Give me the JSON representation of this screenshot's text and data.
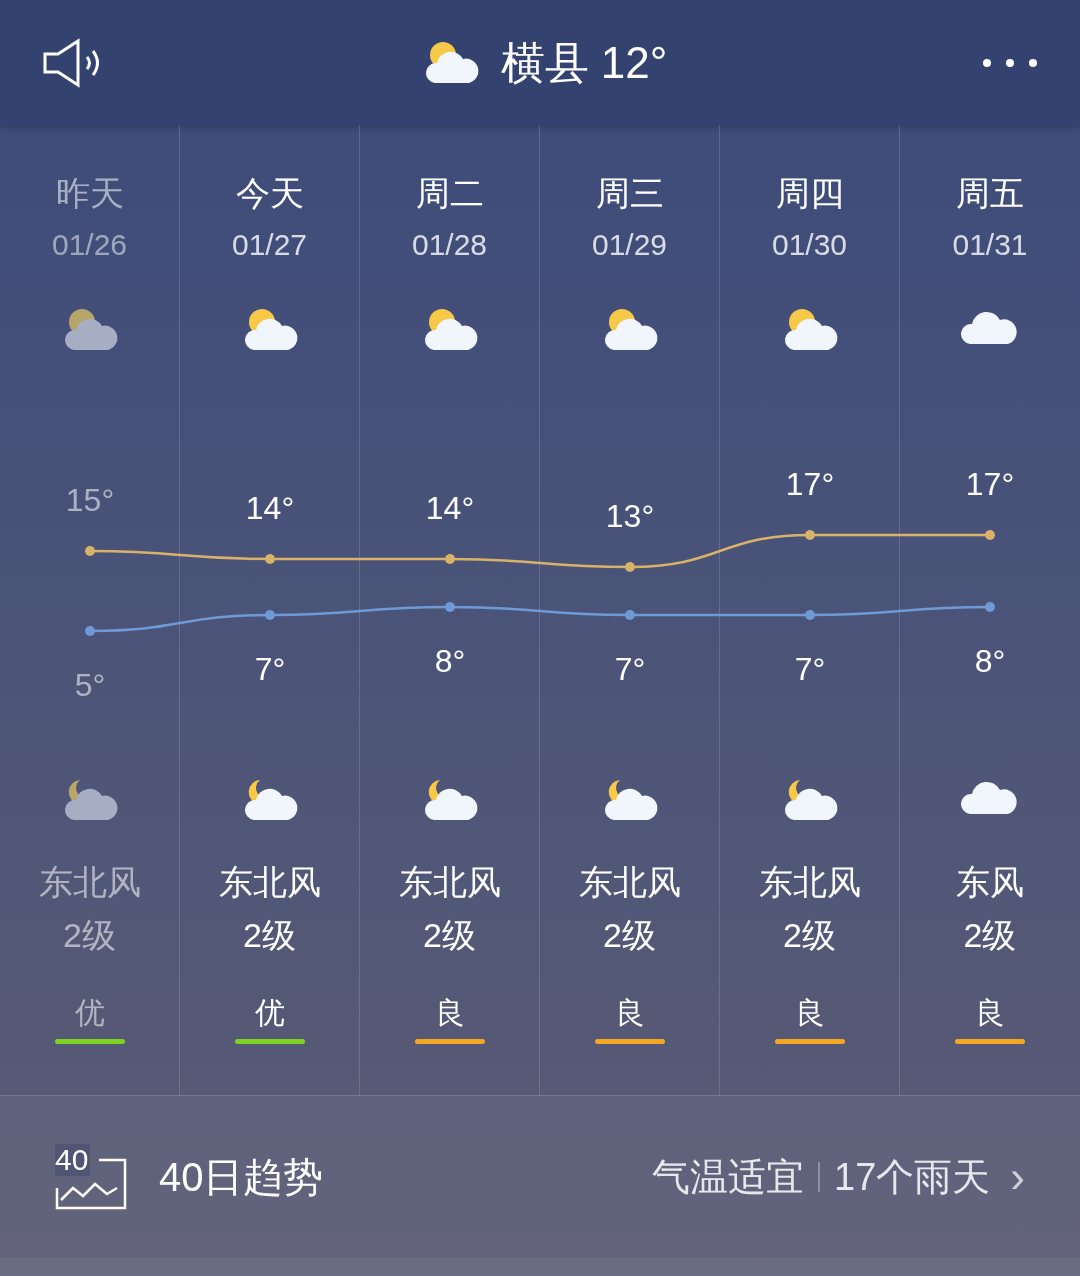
{
  "header": {
    "weather_icon": {
      "kind": "partly_cloudy"
    },
    "title": "横县 12°"
  },
  "forecast": {
    "days": [
      {
        "name": "昨天",
        "date": "01/26",
        "day_icon": {
          "kind": "partly_cloudy"
        },
        "night_icon": {
          "kind": "partly_cloudy_night"
        },
        "wind": "东北风",
        "wind_level": "2级",
        "aqi": "优",
        "color": "#7ed321",
        "past": true
      },
      {
        "name": "今天",
        "date": "01/27",
        "day_icon": {
          "kind": "partly_cloudy"
        },
        "night_icon": {
          "kind": "partly_cloudy_night"
        },
        "wind": "东北风",
        "wind_level": "2级",
        "aqi": "优",
        "color": "#7ed321",
        "past": false
      },
      {
        "name": "周二",
        "date": "01/28",
        "day_icon": {
          "kind": "partly_cloudy"
        },
        "night_icon": {
          "kind": "partly_cloudy_night"
        },
        "wind": "东北风",
        "wind_level": "2级",
        "aqi": "良",
        "color": "#f5a623",
        "past": false
      },
      {
        "name": "周三",
        "date": "01/29",
        "day_icon": {
          "kind": "partly_cloudy"
        },
        "night_icon": {
          "kind": "partly_cloudy_night"
        },
        "wind": "东北风",
        "wind_level": "2级",
        "aqi": "良",
        "color": "#f5a623",
        "past": false
      },
      {
        "name": "周四",
        "date": "01/30",
        "day_icon": {
          "kind": "partly_cloudy"
        },
        "night_icon": {
          "kind": "partly_cloudy_night"
        },
        "wind": "东北风",
        "wind_level": "2级",
        "aqi": "良",
        "color": "#f5a623",
        "past": false
      },
      {
        "name": "周五",
        "date": "01/31",
        "day_icon": {
          "kind": "cloudy"
        },
        "night_icon": {
          "kind": "cloudy"
        },
        "wind": "东风",
        "wind_level": "2级",
        "aqi": "良",
        "color": "#f5a623",
        "past": false
      }
    ],
    "chart_data": {
      "type": "line",
      "series": [
        {
          "color": "#d9b26a",
          "marker": "circle",
          "values": [
            15,
            14,
            14,
            13,
            17,
            17
          ],
          "value_labels": [
            "15°",
            "14°",
            "14°",
            "13°",
            "17°",
            "17°"
          ]
        },
        {
          "color": "#6f9ad6",
          "marker": "circle",
          "values": [
            5,
            7,
            8,
            7,
            7,
            8
          ],
          "value_labels": [
            "5°",
            "7°",
            "8°",
            "7°",
            "7°",
            "8°"
          ]
        }
      ]
    }
  },
  "trend": {
    "icon_text": "40",
    "label": "40日趋势",
    "summary": "气温适宜",
    "rain_days": "17个雨天",
    "chevron": "›"
  }
}
